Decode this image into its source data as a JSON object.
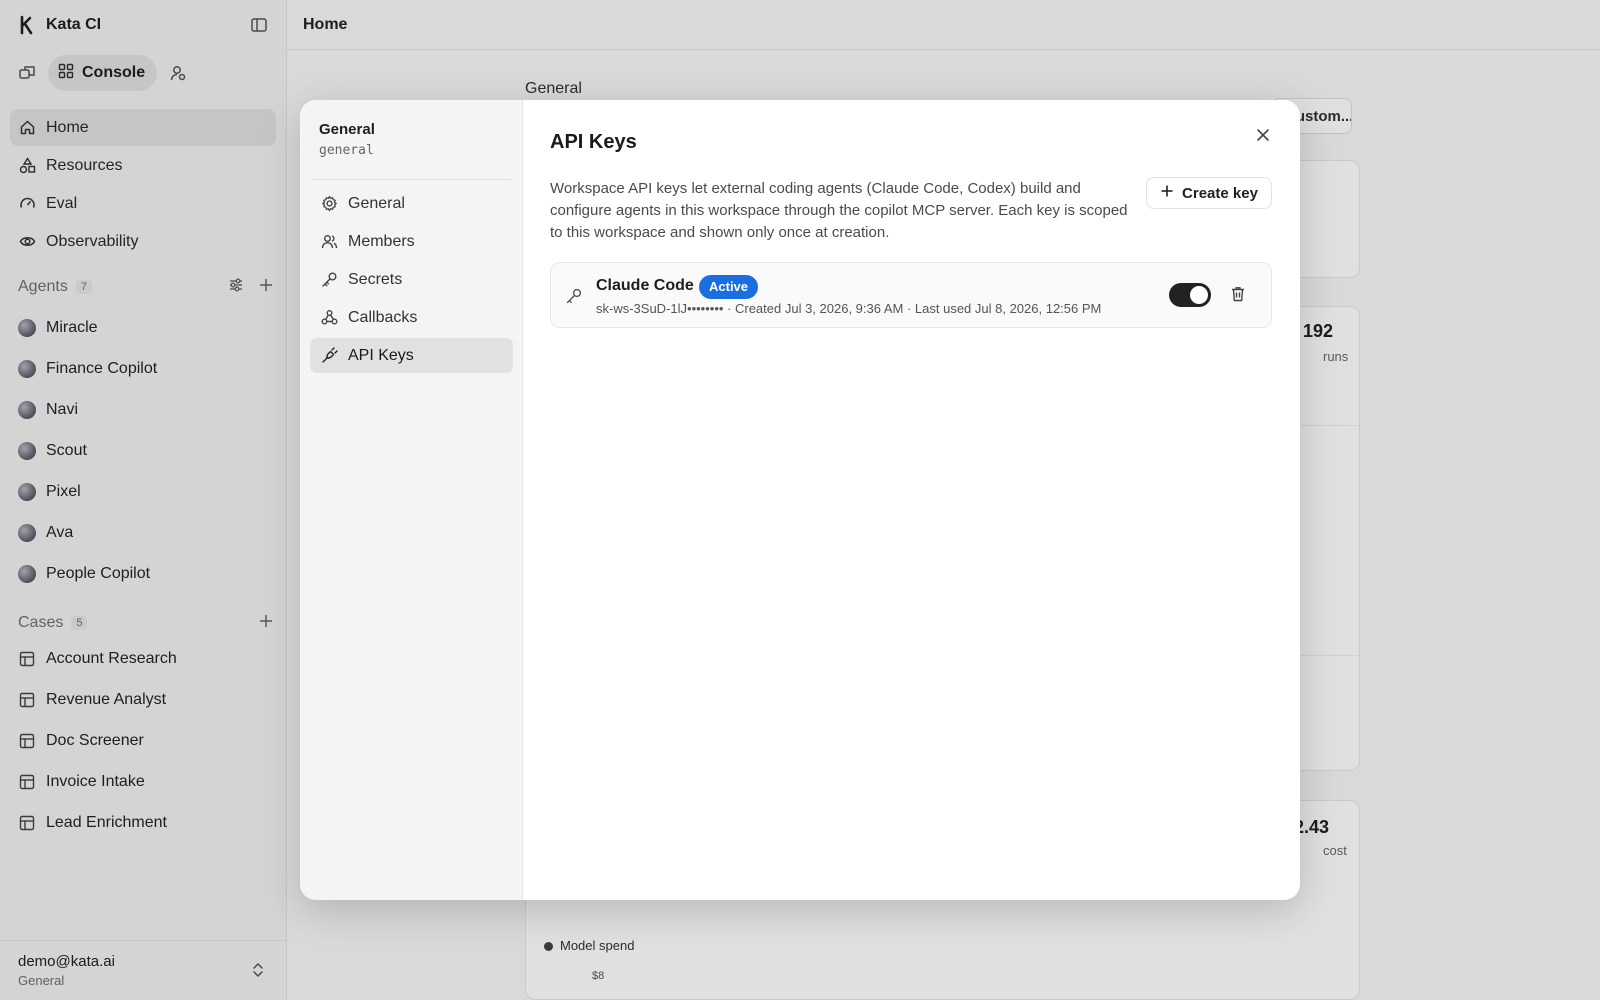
{
  "app": {
    "name": "Kata CI"
  },
  "modes": {
    "console_label": "Console"
  },
  "nav": [
    {
      "label": "Home",
      "icon": "home-icon",
      "active": true
    },
    {
      "label": "Resources",
      "icon": "shapes-icon"
    },
    {
      "label": "Eval",
      "icon": "gauge-icon"
    },
    {
      "label": "Observability",
      "icon": "eye-icon"
    }
  ],
  "agents": {
    "title": "Agents",
    "count": "7",
    "items": [
      "Miracle",
      "Finance Copilot",
      "Navi",
      "Scout",
      "Pixel",
      "Ava",
      "People Copilot"
    ]
  },
  "cases": {
    "title": "Cases",
    "count": "5",
    "items": [
      "Account Research",
      "Revenue Analyst",
      "Doc Screener",
      "Invoice Intake",
      "Lead Enrichment"
    ]
  },
  "user": {
    "email": "demo@kata.ai",
    "workspace": "General"
  },
  "topbar": {
    "title": "Home"
  },
  "background": {
    "section_label": "General",
    "button_label": "Custom...",
    "stat1_value": "192",
    "stat1_label": "runs",
    "stat2_value": "22.43",
    "stat2_label": "cost",
    "legend_label": "Model spend",
    "axis_tick": "$8"
  },
  "modal": {
    "workspace_name": "General",
    "workspace_slug": "general",
    "settings_items": [
      {
        "label": "General",
        "icon": "gear-icon"
      },
      {
        "label": "Members",
        "icon": "users-icon"
      },
      {
        "label": "Secrets",
        "icon": "key-icon"
      },
      {
        "label": "Callbacks",
        "icon": "webhook-icon"
      },
      {
        "label": "API Keys",
        "icon": "plug-icon",
        "active": true
      }
    ],
    "title": "API Keys",
    "description": "Workspace API keys let external coding agents (Claude Code, Codex) build and configure agents in this workspace through the copilot MCP server. Each key is scoped to this workspace and shown only once at creation.",
    "create_label": "Create key",
    "keys": [
      {
        "name": "Claude Code",
        "status": "Active",
        "meta": "sk-ws-3SuD-1lJ•••••••• · Created Jul 3, 2026, 9:36 AM · Last used Jul 8, 2026, 12:56 PM",
        "enabled": true
      }
    ]
  },
  "colors": {
    "accent": "#1a6fe0",
    "toggle_on": "#222222"
  }
}
